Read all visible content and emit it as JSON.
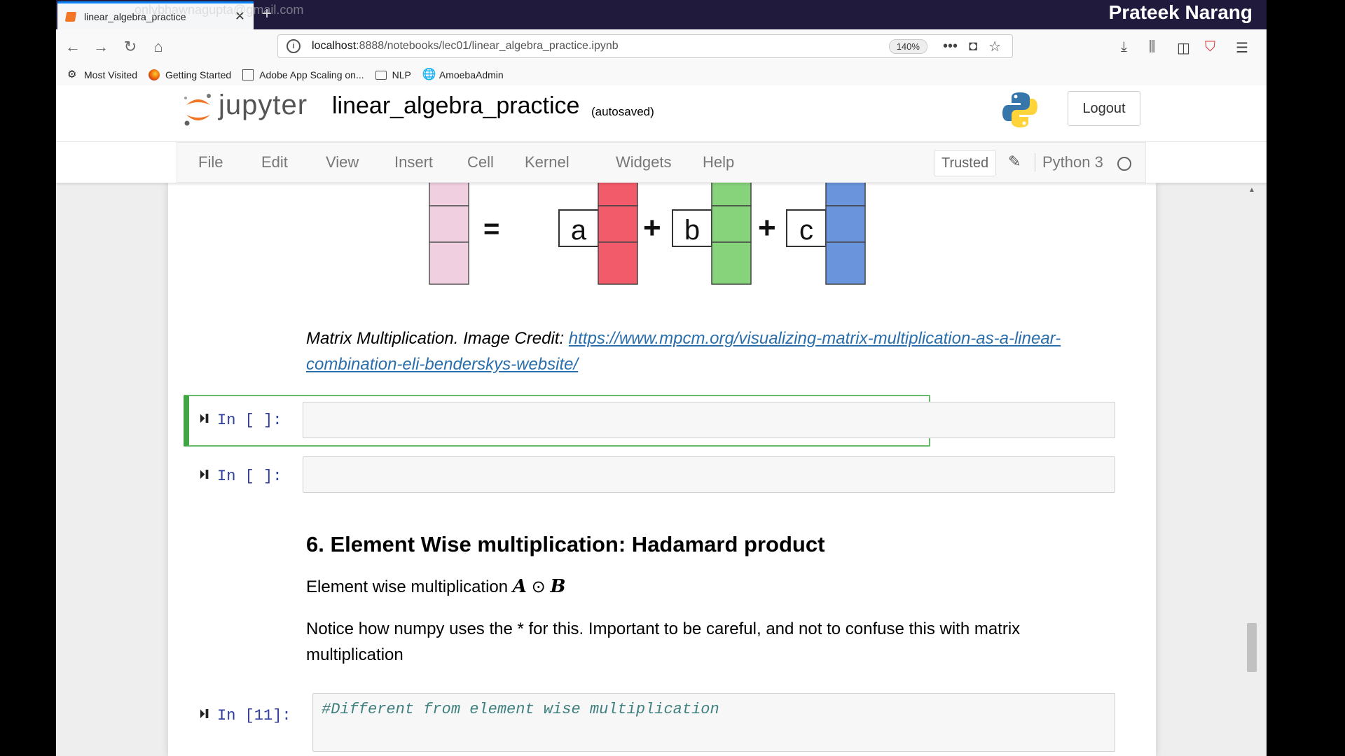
{
  "browser": {
    "tab_title": "linear_algebra_practice",
    "watermark_email": "onlybhawnagupta@gmail.com",
    "presenter_name": "Prateek Narang",
    "url_host": "localhost",
    "url_rest": ":8888/notebooks/lec01/linear_algebra_practice.ipynb",
    "zoom": "140%",
    "bookmarks": [
      {
        "label": "Most Visited",
        "icon": "gear-icon"
      },
      {
        "label": "Getting Started",
        "icon": "firefox-icon"
      },
      {
        "label": "Adobe App Scaling on...",
        "icon": "adobe-icon"
      },
      {
        "label": "NLP",
        "icon": "folder-icon"
      },
      {
        "label": "AmoebaAdmin",
        "icon": "globe-icon"
      }
    ]
  },
  "jupyter": {
    "logo_text": "jupyter",
    "notebook_name": "linear_algebra_practice",
    "autosave_status": "(autosaved)",
    "logout_label": "Logout",
    "menus": [
      "File",
      "Edit",
      "View",
      "Insert",
      "Cell",
      "Kernel",
      "Widgets",
      "Help"
    ],
    "trusted_label": "Trusted",
    "kernel_name": "Python 3"
  },
  "notebook": {
    "figure": {
      "labels": [
        "a",
        "b",
        "c"
      ],
      "equals": "=",
      "plus": "+",
      "colors": {
        "result": "#f0cfe0",
        "a": "#f25b6a",
        "b": "#86d37c",
        "c": "#6a95dc"
      }
    },
    "caption_text": "Matrix Multiplication. Image Credit: ",
    "caption_link": "https://www.mpcm.org/visualizing-matrix-multiplication-as-a-linear-combination-eli-benderskys-website/",
    "cells": [
      {
        "prompt": "In [ ]:"
      },
      {
        "prompt": "In [ ]:"
      }
    ],
    "heading": "6. Element Wise multiplication: Hadamard product",
    "para1_text": "Element wise multiplication ",
    "math_A": "A",
    "math_op": "⊙",
    "math_B": "B",
    "para2": "Notice how numpy uses the * for this. Important to be careful, and not to confuse this with matrix multiplication",
    "code_cell": {
      "prompt": "In [11]:",
      "code": "#Different from element wise multiplication"
    }
  }
}
